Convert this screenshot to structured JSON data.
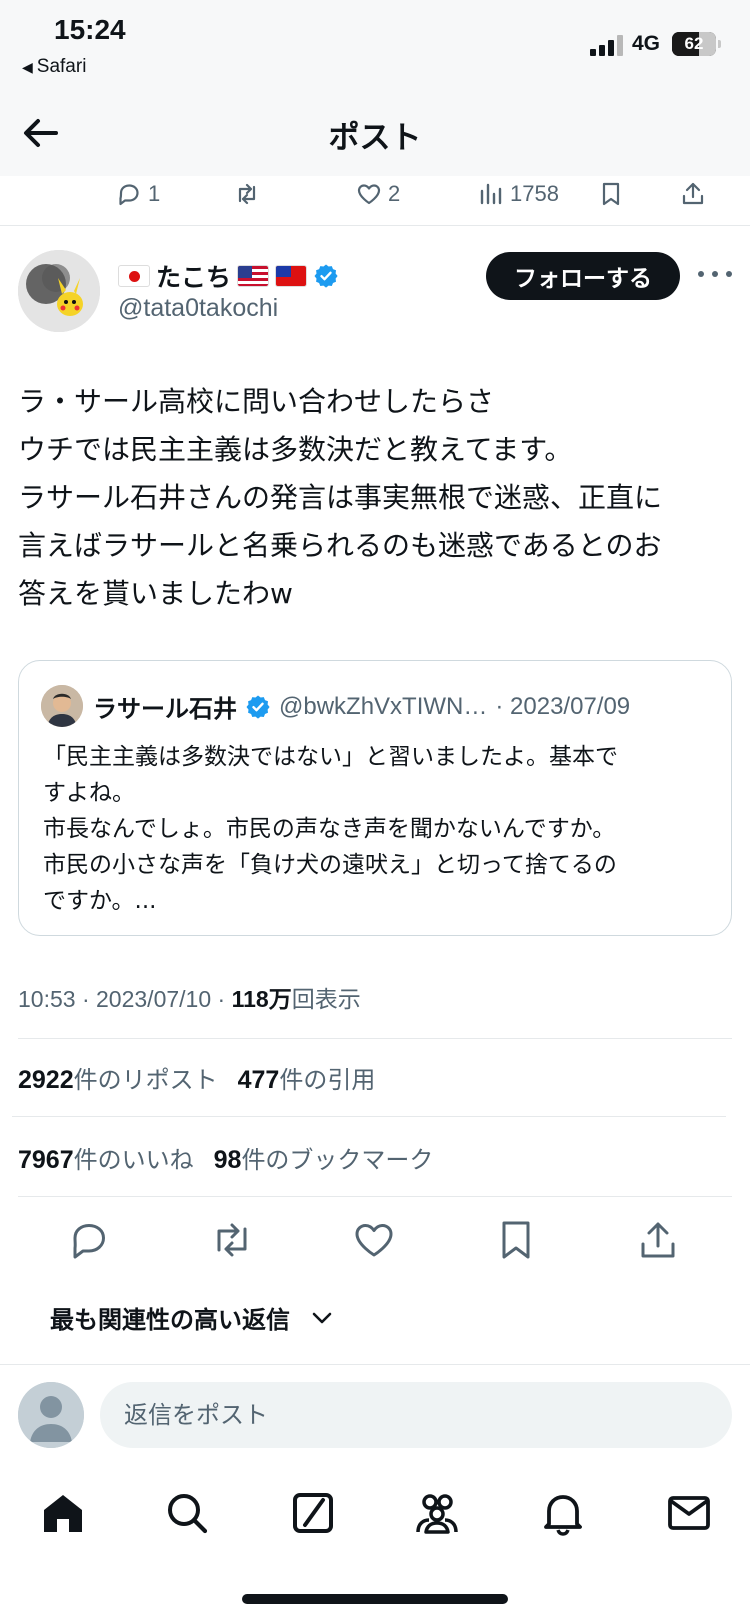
{
  "status_bar": {
    "time": "15:24",
    "back_app": "Safari",
    "network": "4G",
    "battery_percent": 62,
    "battery_text": "62"
  },
  "header": {
    "title": "ポスト"
  },
  "parent_metrics": {
    "replies": "1",
    "likes": "2",
    "views": "1758"
  },
  "author": {
    "name": "たこち",
    "handle": "@tata0takochi",
    "verified": true,
    "follow_label": "フォローする"
  },
  "post": {
    "lines": [
      "ラ・サール高校に問い合わせしたらさ",
      "ウチでは民主主義は多数決だと教えてます。",
      "ラサール石井さんの発言は事実無根で迷惑、正直に",
      "言えばラサールと名乗られるのも迷惑であるとのお",
      "答えを貰いましたわw"
    ],
    "time": "10:53",
    "date": "2023/07/10",
    "views_num": "118万",
    "views_suffix": "回表示"
  },
  "quote": {
    "name": "ラサール石井",
    "handle": "@bwkZhVxTIWN…",
    "date": "· 2023/07/09",
    "lines": [
      "「民主主義は多数決ではない」と習いましたよ。基本で",
      "すよね。",
      "市長なんでしょ。市民の声なき声を聞かないんですか。",
      "市民の小さな声を「負け犬の遠吠え」と切って捨てるの",
      "ですか。..."
    ]
  },
  "counts": {
    "reposts_num": "2922",
    "reposts_label": "件のリポスト",
    "quotes_num": "477",
    "quotes_label": "件の引用",
    "likes_num": "7967",
    "likes_label": "件のいいね",
    "bookmarks_num": "98",
    "bookmarks_label": "件のブックマーク"
  },
  "replies_sort": {
    "label": "最も関連性の高い返信"
  },
  "reply_box": {
    "placeholder": "返信をポスト"
  },
  "colors": {
    "text": "#0f1419",
    "muted": "#536471",
    "verified_blue": "#1d9bf0",
    "border": "#cfd9de"
  },
  "icons": {
    "nav": [
      "home-icon",
      "search-icon",
      "grok-icon",
      "communities-icon",
      "notifications-icon",
      "messages-icon"
    ]
  }
}
